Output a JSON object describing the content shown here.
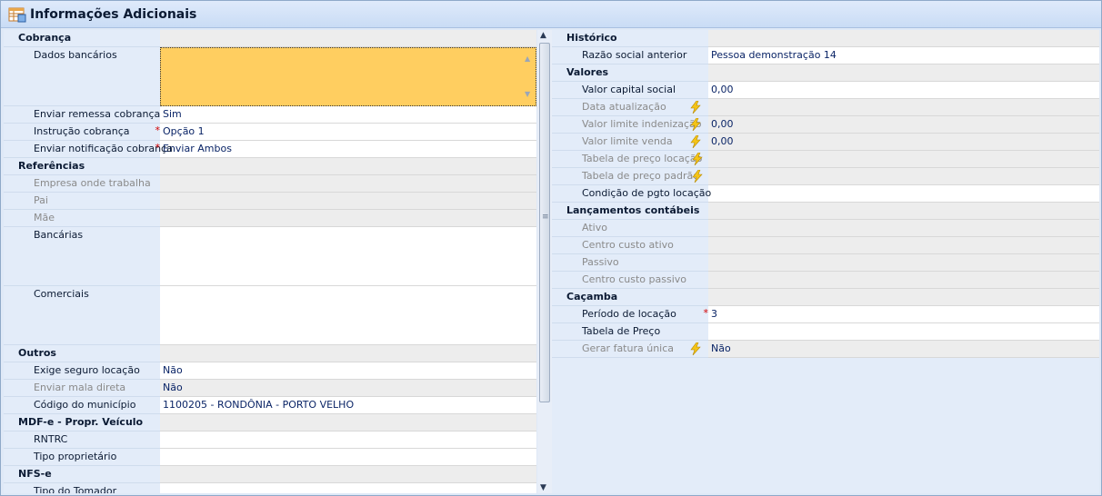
{
  "window": {
    "title": "Informações Adicionais",
    "icon": "table-properties-icon"
  },
  "left": {
    "cobranca": {
      "header": "Cobrança",
      "dados_bancarios": {
        "label": "Dados bancários",
        "value": ""
      },
      "enviar_remessa": {
        "label": "Enviar remessa cobrança",
        "value": "Sim"
      },
      "instrucao": {
        "label": "Instrução cobrança",
        "value": "Opção 1",
        "required": "*"
      },
      "enviar_notificacao": {
        "label": "Enviar notificação cobrança",
        "value": "Enviar Ambos",
        "required": "*"
      }
    },
    "referencias": {
      "header": "Referências",
      "empresa": {
        "label": "Empresa onde trabalha",
        "value": ""
      },
      "pai": {
        "label": "Pai",
        "value": ""
      },
      "mae": {
        "label": "Mãe",
        "value": ""
      },
      "bancarias": {
        "label": "Bancárias",
        "value": ""
      },
      "comerciais": {
        "label": "Comerciais",
        "value": ""
      }
    },
    "outros": {
      "header": "Outros",
      "exige_seguro": {
        "label": "Exige seguro locação",
        "value": "Não"
      },
      "enviar_mala": {
        "label": "Enviar mala direta",
        "value": "Não"
      },
      "codigo_municipio": {
        "label": "Código do município",
        "value": "1100205 - RONDÔNIA - PORTO VELHO"
      }
    },
    "mdfe": {
      "header": "MDF-e - Propr. Veículo",
      "rntrc": {
        "label": "RNTRC",
        "value": ""
      },
      "tipo_proprietario": {
        "label": "Tipo proprietário",
        "value": ""
      }
    },
    "nfse": {
      "header": "NFS-e",
      "tipo_tomador": {
        "label": "Tipo do Tomador",
        "value": ""
      }
    }
  },
  "right": {
    "historico": {
      "header": "Histórico",
      "razao_social": {
        "label": "Razão social anterior",
        "value": "Pessoa demonstração 14"
      }
    },
    "valores": {
      "header": "Valores",
      "capital_social": {
        "label": "Valor capital social",
        "value": "0,00"
      },
      "data_atualizacao": {
        "label": "Data atualização",
        "value": ""
      },
      "limite_indenizacao": {
        "label": "Valor limite indenização",
        "value": "0,00"
      },
      "limite_venda": {
        "label": "Valor limite venda",
        "value": "0,00"
      },
      "tabela_locacao": {
        "label": "Tabela de preço locação",
        "value": ""
      },
      "tabela_padrao": {
        "label": "Tabela de preço padrão",
        "value": ""
      },
      "condicao_pgto": {
        "label": "Condição de pgto locação",
        "value": ""
      }
    },
    "lancamentos": {
      "header": "Lançamentos contábeis",
      "ativo": {
        "label": "Ativo",
        "value": ""
      },
      "centro_ativo": {
        "label": "Centro custo ativo",
        "value": ""
      },
      "passivo": {
        "label": "Passivo",
        "value": ""
      },
      "centro_passivo": {
        "label": "Centro custo passivo",
        "value": ""
      }
    },
    "cacamba": {
      "header": "Caçamba",
      "periodo": {
        "label": "Período de locação",
        "value": "3",
        "required": "*"
      },
      "tabela_preco": {
        "label": "Tabela de Preço",
        "value": ""
      },
      "fatura_unica": {
        "label": "Gerar fatura única",
        "value": "Não"
      }
    }
  },
  "colors": {
    "accent_field": "#ffce60",
    "value_text": "#0a2466",
    "required_mark": "#d40000"
  }
}
